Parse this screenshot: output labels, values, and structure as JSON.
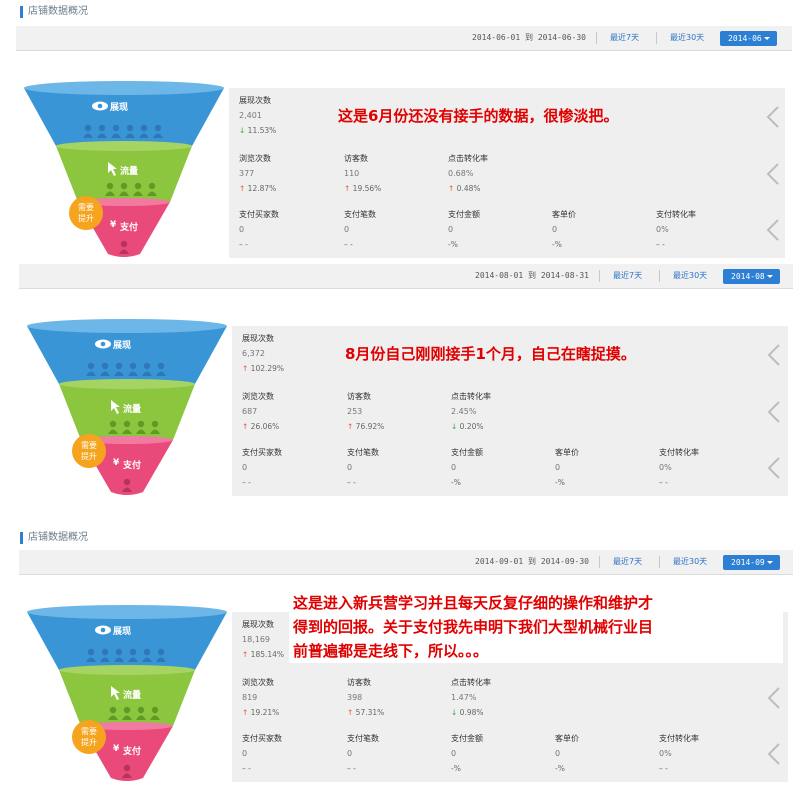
{
  "section_title": "店铺数据概况",
  "colors": {
    "blue": "#3a95d6",
    "green": "#8cc63f",
    "pink": "#e94a7a",
    "badge": "#f6a31d",
    "note": "#e00000"
  },
  "panels": [
    {
      "date_from": "2014-06-01",
      "date_to": "2014-06-30",
      "to_label": "到",
      "recent7": "最近7天",
      "recent30": "最近30天",
      "month": "2014-06",
      "funnel": {
        "show": "展现",
        "traffic": "流量",
        "pay": "支付",
        "badge_line1": "需要",
        "badge_line2": "提升"
      },
      "note": "这是6月份还没有接手的数据，很惨淡把。",
      "row1": [
        {
          "label": "展现次数",
          "value": "2,401",
          "change": "11.53%",
          "dir": "down"
        }
      ],
      "row2": [
        {
          "label": "浏览次数",
          "value": "377",
          "change": "12.87%",
          "dir": "up"
        },
        {
          "label": "访客数",
          "value": "110",
          "change": "19.56%",
          "dir": "up"
        },
        {
          "label": "点击转化率",
          "value": "0.68%",
          "change": "0.48%",
          "dir": "up"
        }
      ],
      "row3": [
        {
          "label": "支付买家数",
          "value": "0",
          "change": "– -"
        },
        {
          "label": "支付笔数",
          "value": "0",
          "change": "– -"
        },
        {
          "label": "支付金额",
          "value": "0",
          "change": "-%"
        },
        {
          "label": "客单价",
          "value": "0",
          "change": "-%"
        },
        {
          "label": "支付转化率",
          "value": "0%",
          "change": "– -"
        }
      ]
    },
    {
      "date_from": "2014-08-01",
      "date_to": "2014-08-31",
      "to_label": "到",
      "recent7": "最近7天",
      "recent30": "最近30天",
      "month": "2014-08",
      "funnel": {
        "show": "展现",
        "traffic": "流量",
        "pay": "支付",
        "badge_line1": "需要",
        "badge_line2": "提升"
      },
      "note": "8月份自己刚刚接手1个月，自己在瞎捉摸。",
      "row1": [
        {
          "label": "展现次数",
          "value": "6,372",
          "change": "102.29%",
          "dir": "up"
        }
      ],
      "row2": [
        {
          "label": "浏览次数",
          "value": "687",
          "change": "26.06%",
          "dir": "up"
        },
        {
          "label": "访客数",
          "value": "253",
          "change": "76.92%",
          "dir": "up"
        },
        {
          "label": "点击转化率",
          "value": "2.45%",
          "change": "0.20%",
          "dir": "down"
        }
      ],
      "row3": [
        {
          "label": "支付买家数",
          "value": "0",
          "change": "– -"
        },
        {
          "label": "支付笔数",
          "value": "0",
          "change": "– -"
        },
        {
          "label": "支付金额",
          "value": "0",
          "change": "-%"
        },
        {
          "label": "客单价",
          "value": "0",
          "change": "-%"
        },
        {
          "label": "支付转化率",
          "value": "0%",
          "change": "– -"
        }
      ]
    },
    {
      "date_from": "2014-09-01",
      "date_to": "2014-09-30",
      "to_label": "到",
      "recent7": "最近7天",
      "recent30": "最近30天",
      "month": "2014-09",
      "funnel": {
        "show": "展现",
        "traffic": "流量",
        "pay": "支付",
        "badge_line1": "需要",
        "badge_line2": "提升"
      },
      "note_lines": [
        "这是进入新兵营学习并且每天反复仔细的操作和维护才",
        "得到的回报。关于支付我先申明下我们大型机械行业目",
        "前普遍都是走线下，所以。。。"
      ],
      "row1": [
        {
          "label": "展现次数",
          "value": "18,169",
          "change": "185.14%",
          "dir": "up"
        }
      ],
      "row2": [
        {
          "label": "浏览次数",
          "value": "819",
          "change": "19.21%",
          "dir": "up"
        },
        {
          "label": "访客数",
          "value": "398",
          "change": "57.31%",
          "dir": "up"
        },
        {
          "label": "点击转化率",
          "value": "1.47%",
          "change": "0.98%",
          "dir": "down"
        }
      ],
      "row3": [
        {
          "label": "支付买家数",
          "value": "0",
          "change": "– -"
        },
        {
          "label": "支付笔数",
          "value": "0",
          "change": "– -"
        },
        {
          "label": "支付金额",
          "value": "0",
          "change": "-%"
        },
        {
          "label": "客单价",
          "value": "0",
          "change": "-%"
        },
        {
          "label": "支付转化率",
          "value": "0%",
          "change": "– -"
        }
      ]
    }
  ]
}
